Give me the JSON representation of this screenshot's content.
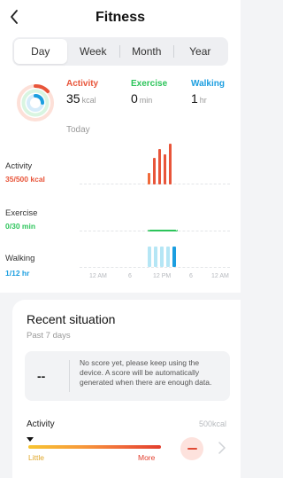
{
  "header": {
    "title": "Fitness"
  },
  "tabs": [
    {
      "label": "Day",
      "active": true
    },
    {
      "label": "Week",
      "active": false
    },
    {
      "label": "Month",
      "active": false
    },
    {
      "label": "Year",
      "active": false
    }
  ],
  "summary": {
    "activity": {
      "label": "Activity",
      "value": "35",
      "unit": "kcal",
      "color": "#e8553a"
    },
    "exercise": {
      "label": "Exercise",
      "value": "0",
      "unit": "min",
      "color": "#2cc45a"
    },
    "walking": {
      "label": "Walking",
      "value": "1",
      "unit": "hr",
      "color": "#1b9ee0"
    },
    "date_label": "Today"
  },
  "rows": {
    "activity": {
      "label": "Activity",
      "value": "35/500 kcal",
      "color": "#e8553a"
    },
    "exercise": {
      "label": "Exercise",
      "value": "0/30 min",
      "color": "#2cc45a"
    },
    "walking": {
      "label": "Walking",
      "value": "1/12 hr",
      "color": "#1b9ee0"
    }
  },
  "time_axis": [
    "12 AM",
    "6",
    "12 PM",
    "6",
    "12 AM"
  ],
  "recent": {
    "title": "Recent situation",
    "subtitle": "Past 7 days",
    "score": "--",
    "message": "No score yet, please keep using the device. A score will be automatically generated when there are enough data.",
    "activity_label": "Activity",
    "activity_target": "500kcal",
    "scale_low": "Little",
    "scale_high": "More"
  }
}
